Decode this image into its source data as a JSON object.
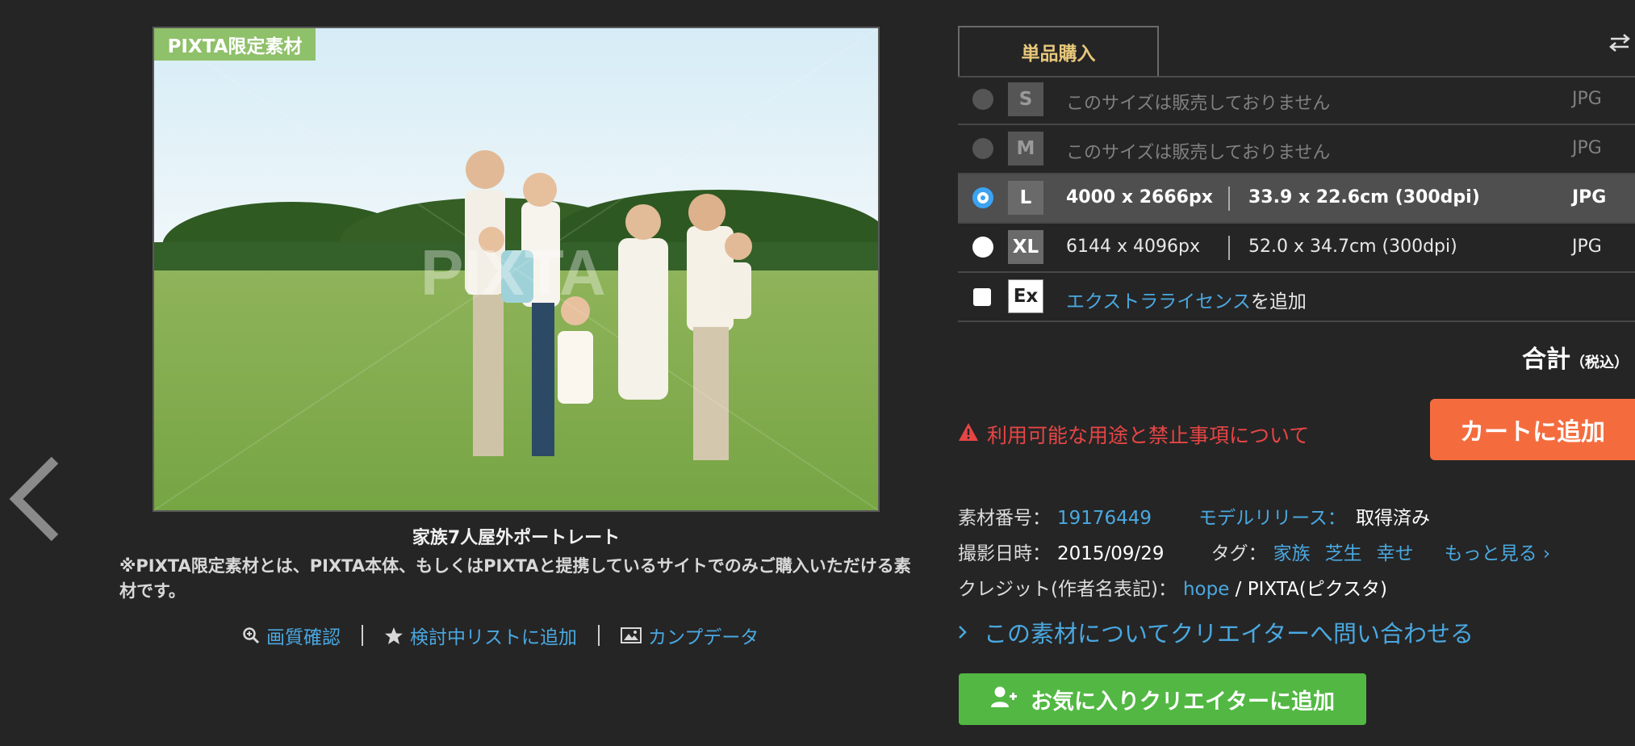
{
  "photo": {
    "badge": "PIXTA限定素材",
    "watermark": "PIXTA",
    "caption": "家族7人屋外ポートレート",
    "note": "※PIXTA限定素材とは、PIXTA本体、もしくはPIXTAと提携しているサイトでのみご購入いただける素材です。"
  },
  "actions": {
    "zoom_label": "画質確認",
    "wishlist_label": "検討中リストに追加",
    "comp_label": "カンプデータ"
  },
  "purchase": {
    "tab_label": "単品購入",
    "rows": [
      {
        "size": "S",
        "unavailable": "このサイズは販売しておりません",
        "format": "JPG"
      },
      {
        "size": "M",
        "unavailable": "このサイズは販売しておりません",
        "format": "JPG"
      },
      {
        "size": "L",
        "pixels": "4000 x 2666px",
        "print": "33.9 x 22.6cm (300dpi)",
        "format": "JPG"
      },
      {
        "size": "XL",
        "pixels": "6144 x 4096px",
        "print": "52.0 x 34.7cm (300dpi)",
        "format": "JPG"
      }
    ],
    "extra": {
      "badge": "Ex",
      "link": "エクストラライセンス",
      "suffix": "を追加"
    },
    "total_label": "合計",
    "tax_label": "（税込）",
    "warning": "利用可能な用途と禁止事項について",
    "cart_button": "カートに追加"
  },
  "meta": {
    "id_label": "素材番号：",
    "id_value": "19176449",
    "release_label": "モデルリリース：",
    "release_value": "取得済み",
    "date_label": "撮影日時：",
    "date_value": "2015/09/29",
    "tag_label": "タグ：",
    "tags": [
      "家族",
      "芝生",
      "幸せ"
    ],
    "more_label": "もっと見る ›",
    "credit_label": "クレジット(作者名表記)：",
    "credit_author": "hope",
    "credit_sep": " / ",
    "credit_site": "PIXTA(ピクスタ)"
  },
  "inquiry": "この素材についてクリエイターへ問い合わせる",
  "fav_button": "お気に入りクリエイターに追加",
  "colors": {
    "link": "#4aa8e0",
    "cart": "#f46c3e",
    "fav": "#52b843",
    "warning": "#e64545",
    "badge": "#8fc06a"
  }
}
